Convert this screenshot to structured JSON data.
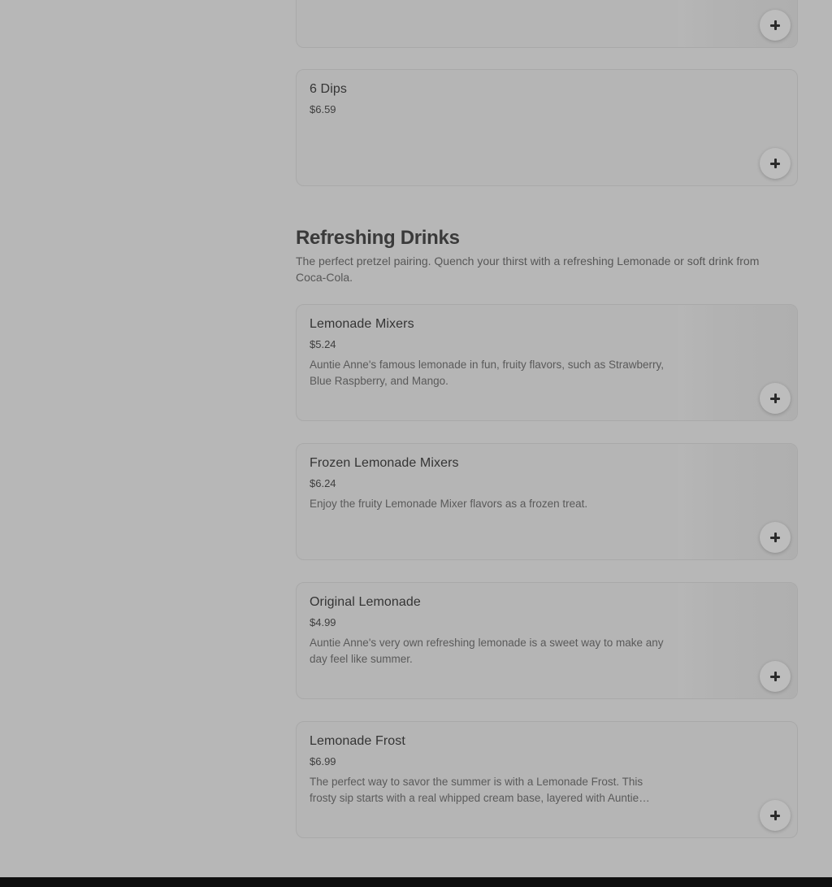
{
  "previous_items": [
    {
      "name": "",
      "price": "",
      "description": ""
    },
    {
      "name": "6 Dips",
      "price": "$6.59",
      "description": ""
    }
  ],
  "section": {
    "title": "Refreshing Drinks",
    "description": "The perfect pretzel pairing. Quench your thirst with a refreshing Lemonade or soft drink from Coca-Cola."
  },
  "items": [
    {
      "name": "Lemonade Mixers",
      "price": "$5.24",
      "description": "Auntie Anne's famous lemonade in fun, fruity flavors, such as Strawberry, Blue Raspberry, and Mango."
    },
    {
      "name": "Frozen Lemonade Mixers",
      "price": "$6.24",
      "description": "Enjoy the fruity Lemonade Mixer flavors as a frozen treat."
    },
    {
      "name": "Original Lemonade",
      "price": "$4.99",
      "description": "Auntie Anne's very own refreshing lemonade is a sweet way to make any day feel like summer."
    },
    {
      "name": "Lemonade Frost",
      "price": "$6.99",
      "description": "The perfect way to savor the summer is with a Lemonade Frost. This frosty sip starts with a real whipped cream base, layered with Auntie Anne's Lemonade."
    }
  ],
  "icons": {
    "add": "plus-icon"
  },
  "colors": {
    "overlay_background": "#b7b7b7",
    "footer": "#0f0f0f"
  }
}
